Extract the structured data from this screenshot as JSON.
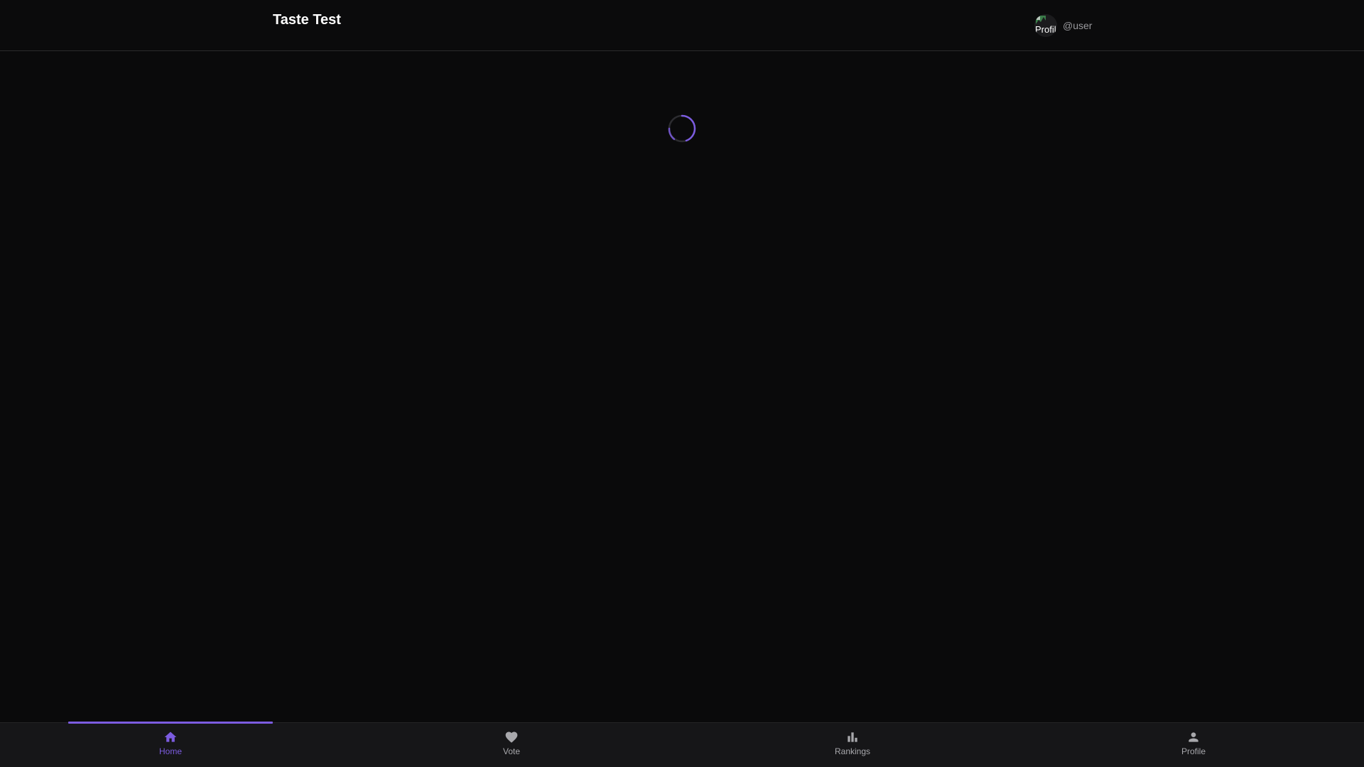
{
  "header": {
    "title": "Taste Test",
    "username": "@user",
    "avatar_alt": "Profile",
    "avatar_icon": "profile-avatar-image"
  },
  "main": {
    "status": "loading",
    "spinner_color": "#7c5ce0"
  },
  "bottom_nav": {
    "items": [
      {
        "label": "Home",
        "icon": "home-icon",
        "active": true
      },
      {
        "label": "Vote",
        "icon": "heart-icon",
        "active": false
      },
      {
        "label": "Rankings",
        "icon": "bar-chart-icon",
        "active": false
      },
      {
        "label": "Profile",
        "icon": "person-icon",
        "active": false
      }
    ]
  },
  "colors": {
    "accent": "#7c5ce0",
    "background": "#0a0a0b",
    "nav_background": "#161618",
    "inactive": "#a8a8ac"
  }
}
